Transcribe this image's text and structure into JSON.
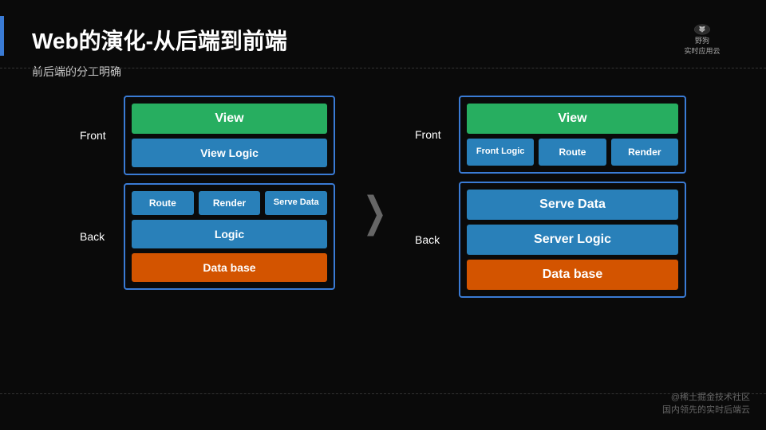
{
  "title": "Web的演化-从后端到前端",
  "subtitle": "前后端的分工明确",
  "logo": {
    "company": "野狗",
    "tagline": "实时应用云"
  },
  "left_diagram": {
    "front_label": "Front",
    "front_blocks": {
      "view": "View",
      "view_logic": "View Logic"
    },
    "back_label": "Back",
    "back_top_blocks": [
      "Route",
      "Render",
      "Serve Data"
    ],
    "back_logic": "Logic",
    "back_database": "Data base"
  },
  "arrow": "❯",
  "right_diagram": {
    "front_label": "Front",
    "front_blocks": {
      "view": "View",
      "row": [
        "Front Logic",
        "Route",
        "Render"
      ]
    },
    "back_label": "Back",
    "back_blocks": {
      "serve_data": "Serve Data",
      "server_logic": "Server Logic",
      "database": "Data base"
    }
  },
  "footer": {
    "line1": "@稀土掘金技术社区",
    "line2": "国内领先的实时后端云"
  }
}
